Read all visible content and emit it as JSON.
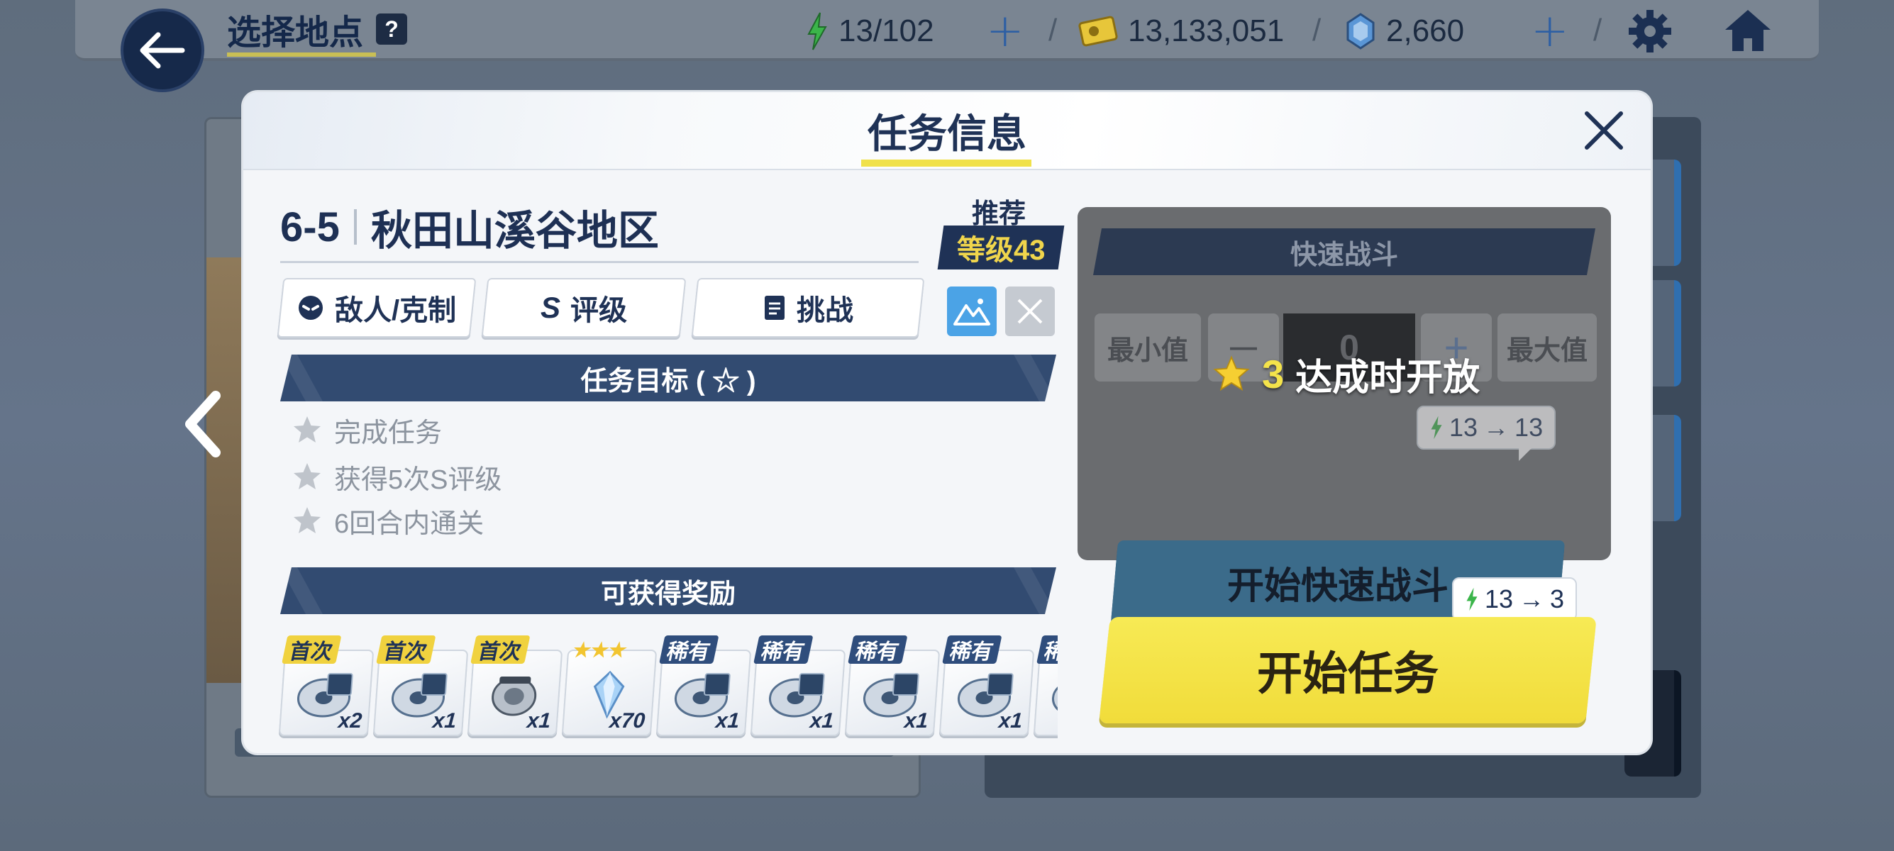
{
  "topbar": {
    "title": "选择地点",
    "help": "?",
    "ap": "13/102",
    "credits": "13,133,051",
    "gems": "2,660",
    "slash": "/"
  },
  "modal": {
    "title": "任务信息",
    "stage_code": "6-5",
    "stage_name": "秋田山溪谷地区",
    "recommend_label": "推荐",
    "recommend_level": "等级43",
    "tabs": {
      "enemy": "敌人/克制",
      "rank": "评级",
      "challenge": "挑战"
    },
    "objectives_header": "任务目标 ( ☆ )",
    "objectives": [
      "完成任务",
      "获得5次S评级",
      "6回合内通关"
    ],
    "rewards_header": "可获得奖励",
    "rewards": [
      {
        "tag": "首次",
        "tag_type": "first",
        "qty": "x2",
        "icon": "disc-item-icon"
      },
      {
        "tag": "首次",
        "tag_type": "first",
        "qty": "x1",
        "icon": "disc-item-icon"
      },
      {
        "tag": "首次",
        "tag_type": "first",
        "qty": "x1",
        "icon": "gear-part-icon"
      },
      {
        "tag": "★★★",
        "tag_type": "stars",
        "qty": "x70",
        "icon": "crystal-icon"
      },
      {
        "tag": "稀有",
        "tag_type": "rare",
        "qty": "x1",
        "icon": "disc-item-icon"
      },
      {
        "tag": "稀有",
        "tag_type": "rare",
        "qty": "x1",
        "icon": "disc-item-icon"
      },
      {
        "tag": "稀有",
        "tag_type": "rare",
        "qty": "x1",
        "icon": "disc-item-icon"
      },
      {
        "tag": "稀有",
        "tag_type": "rare",
        "qty": "x1",
        "icon": "disc-item-icon"
      },
      {
        "tag": "稀",
        "tag_type": "rare",
        "qty": "",
        "icon": "disc-item-icon"
      }
    ],
    "quick": {
      "header": "快速战斗",
      "min": "最小值",
      "minus": "—",
      "value": "0",
      "plus": "+",
      "max": "最大值",
      "lock_num": "3",
      "lock_text": "达成时开放",
      "cost_from": "13",
      "cost_to": "13",
      "start": "开始快速战斗"
    },
    "start": {
      "cost_from": "13",
      "cost_to": "3",
      "label": "开始任务"
    }
  },
  "colors": {
    "navy": "#1f3256",
    "yellow": "#f0d23f",
    "ap_green": "#3bb54a"
  }
}
